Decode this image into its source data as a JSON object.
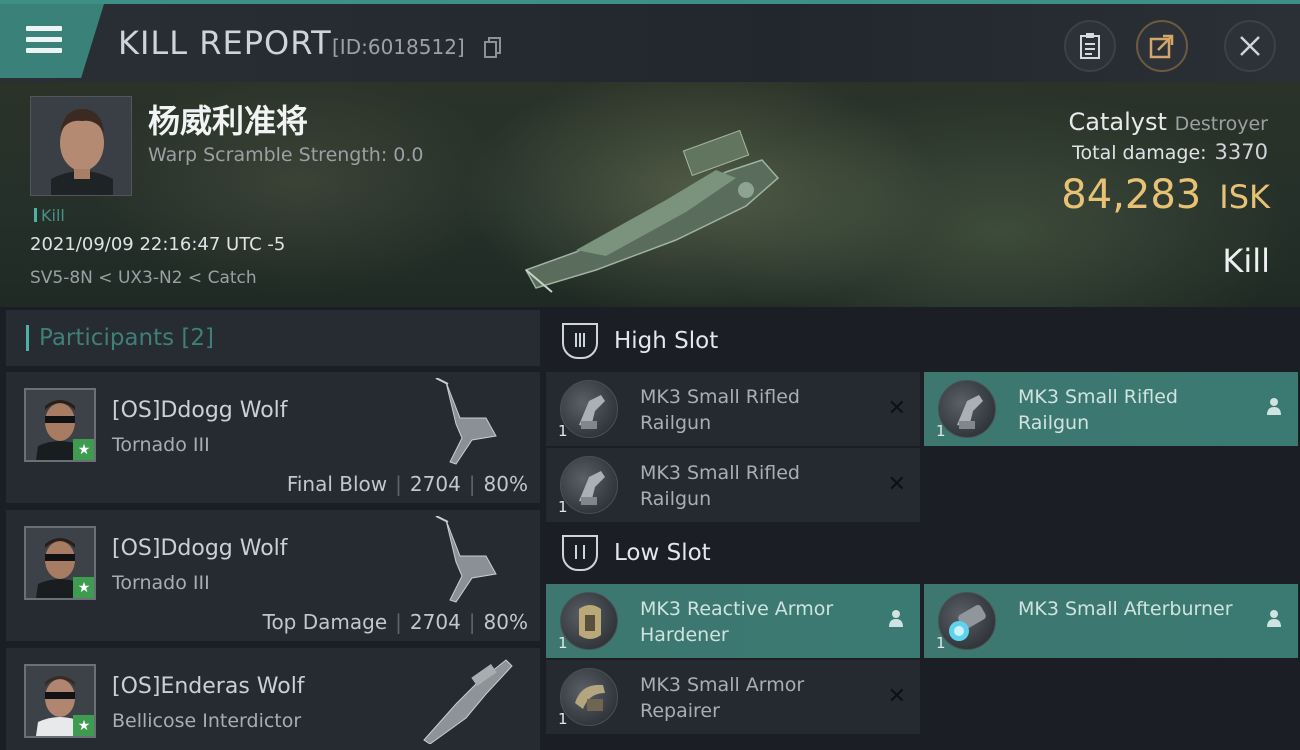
{
  "header": {
    "title": "KILL REPORT",
    "kill_id": "[ID:6018512]"
  },
  "victim": {
    "name": "杨威利准将",
    "scramble": "Warp Scramble Strength: 0.0",
    "tag": "Kill",
    "datetime": "2021/09/09 22:16:47 UTC -5",
    "route": "SV5-8N < UX3-N2 < Catch",
    "ship": "Catalyst",
    "ship_class": "Destroyer",
    "total_damage_label": "Total damage:",
    "total_damage": "3370",
    "isk_value": "84,283",
    "isk_unit": "ISK",
    "result": "Kill"
  },
  "participants": {
    "label": "Participants",
    "count": "[2]",
    "rows": [
      {
        "name": "[OS]Ddogg Wolf",
        "ship": "Tornado III",
        "role": "Final Blow",
        "damage": "2704",
        "pct": "80%"
      },
      {
        "name": "[OS]Ddogg Wolf",
        "ship": "Tornado III",
        "role": "Top Damage",
        "damage": "2704",
        "pct": "80%"
      },
      {
        "name": "[OS]Enderas Wolf",
        "ship": "Bellicose Interdictor"
      }
    ]
  },
  "slots": {
    "high": {
      "label": "High Slot",
      "items": [
        {
          "name": "MK3 Small Rifled Railgun",
          "qty": "1",
          "state": "destroyed"
        },
        {
          "name": "MK3 Small Rifled Railgun",
          "qty": "1",
          "state": "dropped"
        },
        {
          "name": "MK3 Small Rifled Railgun",
          "qty": "1",
          "state": "destroyed"
        }
      ]
    },
    "low": {
      "label": "Low Slot",
      "items": [
        {
          "name": "MK3 Reactive Armor Hardener",
          "qty": "1",
          "state": "dropped"
        },
        {
          "name": "MK3 Small Afterburner",
          "qty": "1",
          "state": "dropped"
        },
        {
          "name": "MK3 Small Armor Repairer",
          "qty": "1",
          "state": "destroyed"
        }
      ]
    }
  },
  "colors": {
    "accent_teal": "#3a817a",
    "isk_gold": "#e8c274"
  }
}
